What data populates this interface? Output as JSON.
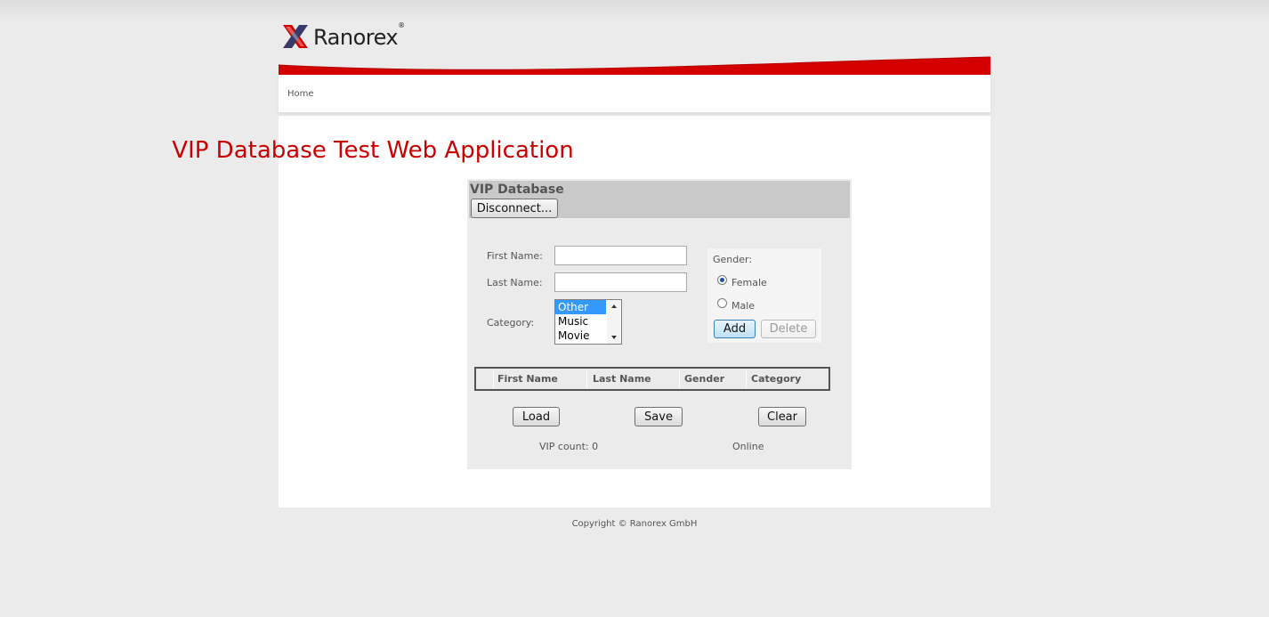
{
  "brand": {
    "name": "Ranorex",
    "registered_mark": "®",
    "accent_color": "#d40000"
  },
  "nav": {
    "home": "Home"
  },
  "page_title": "VIP Database Test Web Application",
  "panel": {
    "title": "VIP Database",
    "disconnect_button": "Disconnect..."
  },
  "form": {
    "first_name_label": "First Name:",
    "first_name_value": "",
    "last_name_label": "Last Name:",
    "last_name_value": "",
    "category_label": "Category:",
    "category_options": [
      "Other",
      "Music",
      "Movie"
    ],
    "category_selected": "Other",
    "gender_label": "Gender:",
    "gender_female": "Female",
    "gender_male": "Male",
    "gender_selected": "Female",
    "add_button": "Add",
    "delete_button": "Delete"
  },
  "table": {
    "columns": [
      "First Name",
      "Last Name",
      "Gender",
      "Category"
    ],
    "rows": []
  },
  "actions": {
    "load": "Load",
    "save": "Save",
    "clear": "Clear"
  },
  "status": {
    "vip_count": "VIP count: 0",
    "connection": "Online"
  },
  "footer": {
    "copyright": "Copyright © Ranorex GmbH"
  }
}
